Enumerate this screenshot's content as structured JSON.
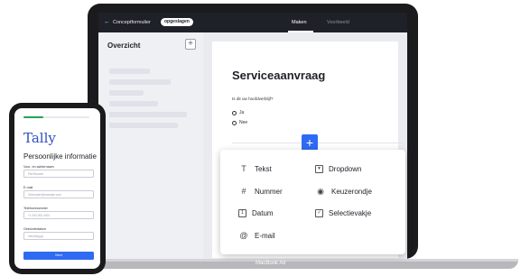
{
  "laptop": {
    "topbar": {
      "back_icon": "arrow-left-icon",
      "title": "Conceptformulier",
      "badge": "opgeslagen",
      "tabs": [
        {
          "label": "Maken",
          "active": true
        },
        {
          "label": "Voorbeeld",
          "active": false
        }
      ]
    },
    "sidebar": {
      "title": "Overzicht",
      "add_icon": "plus-icon",
      "add_label": "+"
    },
    "form": {
      "title": "Serviceaanvraag",
      "question": "Is dit uw hoofdverblijf?",
      "options": [
        "Ja",
        "Nee"
      ],
      "add_block_label": "+"
    },
    "block_menu": {
      "items": [
        {
          "label": "Tekst",
          "icon": "text-icon",
          "glyph": "T"
        },
        {
          "label": "Dropdown",
          "icon": "dropdown-icon",
          "glyph": "▾"
        },
        {
          "label": "Nummer",
          "icon": "hash-icon",
          "glyph": "#"
        },
        {
          "label": "Keuzerondje",
          "icon": "radio-icon",
          "glyph": "◉"
        },
        {
          "label": "Datum",
          "icon": "calendar-icon",
          "glyph": "1"
        },
        {
          "label": "Selectievakje",
          "icon": "checkbox-icon",
          "glyph": "✓"
        },
        {
          "label": "E-mail",
          "icon": "at-sign-icon",
          "glyph": "@"
        }
      ]
    },
    "base_label": "MacBook Air"
  },
  "phone": {
    "progress": 0.3,
    "logo": "Tally",
    "heading": "Persoonlijke informatie",
    "fields": [
      {
        "label": "Voor- en achternaam",
        "placeholder": "Piet Bouwer"
      },
      {
        "label": "E-mail",
        "placeholder": "Onbouwer@example.com"
      },
      {
        "label": "Telefoonnummer",
        "placeholder": "+1 000 000 0000"
      },
      {
        "label": "Geboortedatum",
        "placeholder": "mm/dd/yyyy"
      }
    ],
    "next_label": "Next"
  },
  "colors": {
    "accent": "#2f6bf2",
    "logo": "#2f4fc4",
    "progress": "#22a45a",
    "device": "#1b1b1d"
  }
}
